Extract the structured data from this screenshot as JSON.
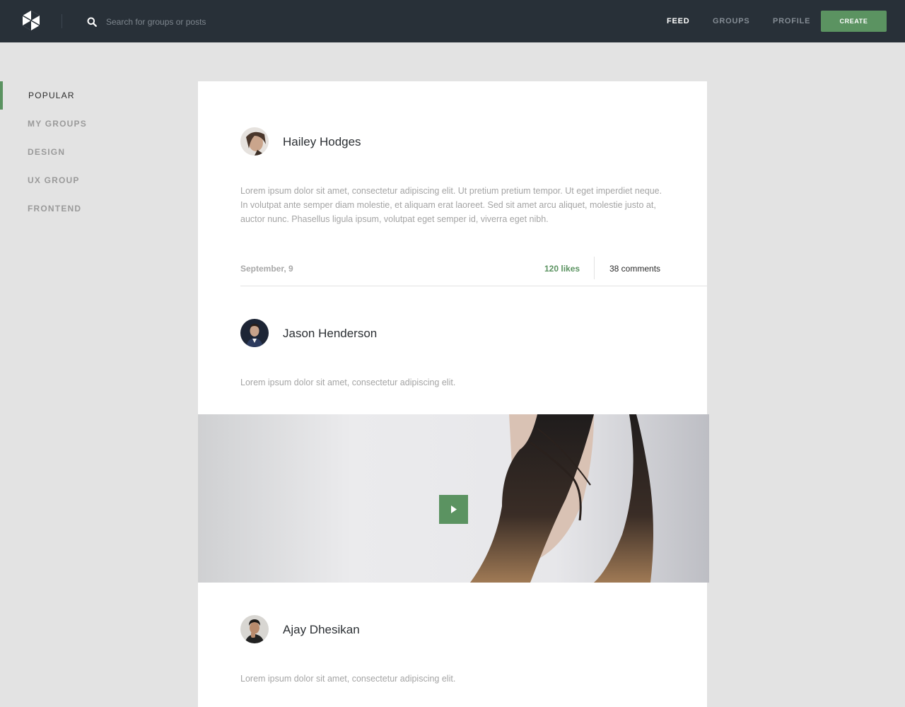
{
  "header": {
    "search_placeholder": "Search for groups or posts",
    "nav": [
      {
        "label": "FEED",
        "active": true
      },
      {
        "label": "GROUPS",
        "active": false
      },
      {
        "label": "PROFILE",
        "active": false
      }
    ],
    "create_label": "CREATE"
  },
  "sidebar": {
    "items": [
      {
        "label": "POPULAR",
        "active": true
      },
      {
        "label": "MY GROUPS",
        "active": false
      },
      {
        "label": "DESIGN",
        "active": false
      },
      {
        "label": "UX GROUP",
        "active": false
      },
      {
        "label": "FRONTEND",
        "active": false
      }
    ]
  },
  "posts": [
    {
      "author": "Hailey Hodges",
      "text": "Lorem ipsum dolor sit amet, consectetur adipiscing elit. Ut pretium pretium tempor. Ut eget imperdiet neque. In volutpat ante semper diam molestie, et aliquam erat laoreet. Sed sit amet arcu aliquet, molestie justo at, auctor nunc. Phasellus ligula ipsum, volutpat eget semper id, viverra eget nibh.",
      "date": "September, 9",
      "likes": "120 likes",
      "comments": "38 comments"
    },
    {
      "author": "Jason Henderson",
      "text": "Lorem ipsum dolor sit amet, consectetur adipiscing elit.",
      "media": "video"
    },
    {
      "author": "Ajay Dhesikan",
      "text": "Lorem ipsum dolor sit amet, consectetur adipiscing elit."
    }
  ],
  "colors": {
    "topbar": "#283038",
    "accent": "#5b9361",
    "page_bg": "#e3e3e3"
  },
  "icons": [
    "logo-icon",
    "search-icon",
    "play-icon"
  ]
}
